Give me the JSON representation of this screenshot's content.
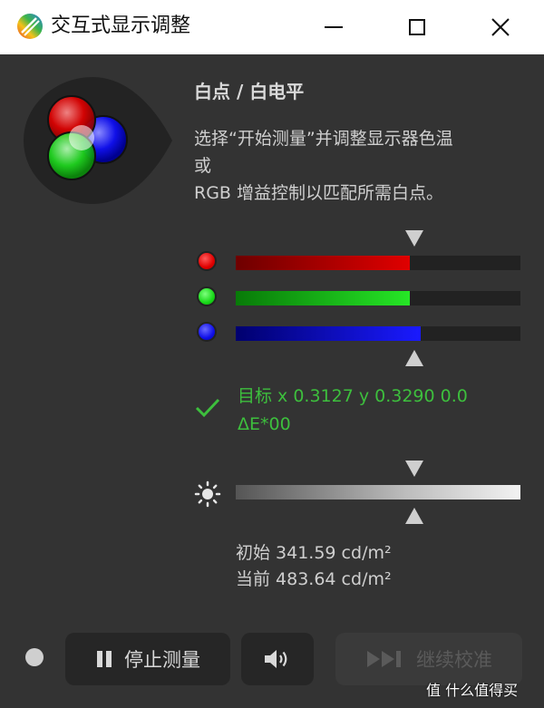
{
  "window": {
    "title": "交互式显示调整",
    "icon": "display-calibration-app-icon"
  },
  "main": {
    "heading": "白点 / 白电平",
    "description_lines": [
      "选择“开始测量”并调整显示器色温",
      "或",
      "RGB 增益控制以匹配所需白点。"
    ],
    "rgb_bars": [
      {
        "channel": "red",
        "level": 0.61,
        "color": "#e00000"
      },
      {
        "channel": "green",
        "level": 0.61,
        "color": "#18d818"
      },
      {
        "channel": "blue",
        "level": 0.65,
        "color": "#1010e8"
      }
    ],
    "rgb_target_level": 0.62,
    "status_color": "#3dbf3d",
    "target_line1": "目标 x 0.3127 y 0.3290 0.0",
    "target_line2": "ΔE*00",
    "luminance": {
      "initial": "初始 341.59 cd/m²",
      "current": "当前 483.64 cd/m²",
      "target_level": 0.62
    }
  },
  "toolbar": {
    "stop_label": "停止测量",
    "continue_label": "继续校准"
  },
  "watermark": "值 什么值得买"
}
